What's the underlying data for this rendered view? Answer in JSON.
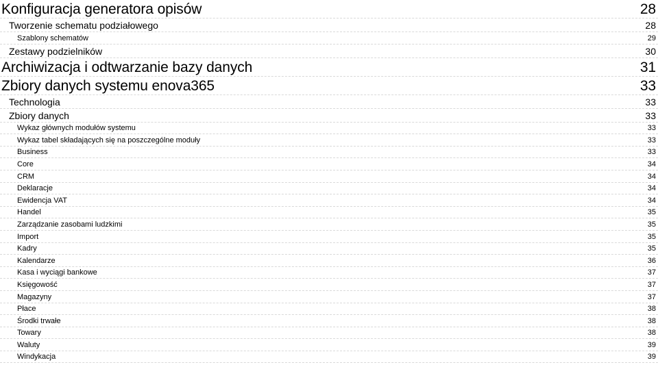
{
  "document": {
    "kind": "table-of-contents",
    "language": "pl",
    "leader_style": "dashed",
    "leader_color": "#d9d9d9",
    "text_color": "#000000",
    "background_color": "#ffffff"
  },
  "entries": [
    {
      "level": 0,
      "label": "Konfiguracja generatora opisów",
      "page": "28"
    },
    {
      "level": 1,
      "label": "Tworzenie schematu podziałowego",
      "page": "28"
    },
    {
      "level": 2,
      "label": "Szablony schematów",
      "page": "29"
    },
    {
      "level": 1,
      "label": "Zestawy podzielników",
      "page": "30"
    },
    {
      "level": 0,
      "label": "Archiwizacja i odtwarzanie bazy danych",
      "page": "31"
    },
    {
      "level": 0,
      "label": "Zbiory danych systemu enova365",
      "page": "33"
    },
    {
      "level": 1,
      "label": "Technologia",
      "page": "33"
    },
    {
      "level": 1,
      "label": "Zbiory danych",
      "page": "33"
    },
    {
      "level": 2,
      "label": "Wykaz głównych modułów systemu",
      "page": "33"
    },
    {
      "level": 2,
      "label": "Wykaz tabel składających się na poszczególne moduły",
      "page": "33"
    },
    {
      "level": 3,
      "label": "Business",
      "page": "33"
    },
    {
      "level": 3,
      "label": "Core",
      "page": "34"
    },
    {
      "level": 3,
      "label": "CRM",
      "page": "34"
    },
    {
      "level": 3,
      "label": "Deklaracje",
      "page": "34"
    },
    {
      "level": 3,
      "label": "Ewidencja VAT",
      "page": "34"
    },
    {
      "level": 3,
      "label": "Handel",
      "page": "35"
    },
    {
      "level": 3,
      "label": "Zarządzanie zasobami ludzkimi",
      "page": "35"
    },
    {
      "level": 3,
      "label": "Import",
      "page": "35"
    },
    {
      "level": 3,
      "label": "Kadry",
      "page": "35"
    },
    {
      "level": 3,
      "label": "Kalendarze",
      "page": "36"
    },
    {
      "level": 3,
      "label": "Kasa i wyciągi bankowe",
      "page": "37"
    },
    {
      "level": 3,
      "label": "Księgowość",
      "page": "37"
    },
    {
      "level": 3,
      "label": "Magazyny",
      "page": "37"
    },
    {
      "level": 3,
      "label": "Płace",
      "page": "38"
    },
    {
      "level": 3,
      "label": "Środki trwałe",
      "page": "38"
    },
    {
      "level": 3,
      "label": "Towary",
      "page": "38"
    },
    {
      "level": 3,
      "label": "Waluty",
      "page": "39"
    },
    {
      "level": 3,
      "label": "Windykacja",
      "page": "39"
    }
  ]
}
